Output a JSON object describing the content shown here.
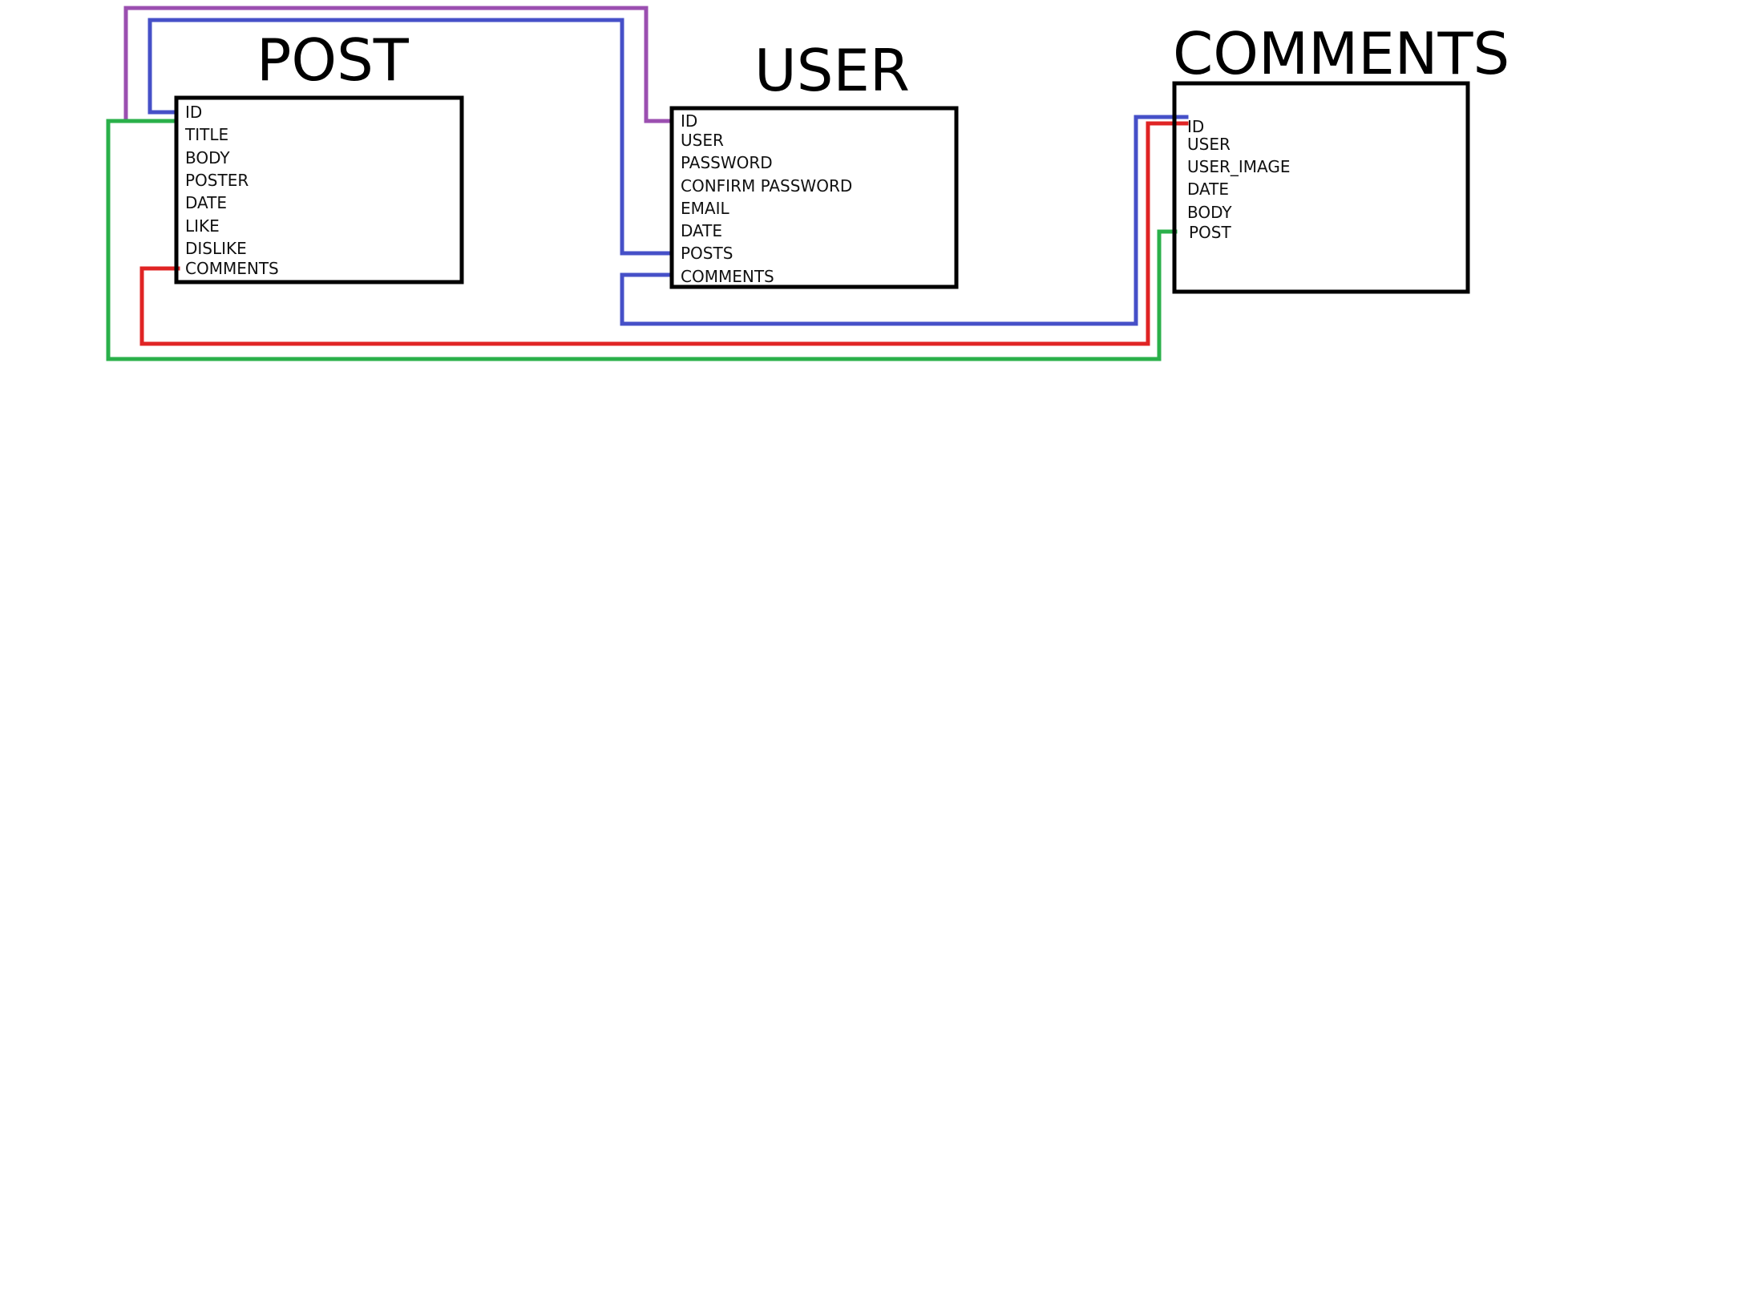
{
  "diagram": {
    "tables": {
      "post": {
        "title": "POST",
        "fields": [
          "ID",
          "TITLE",
          "BODY",
          "POSTER",
          "DATE",
          "LIKE",
          "DISLIKE",
          "COMMENTS"
        ]
      },
      "user": {
        "title": "USER",
        "fields": [
          "ID",
          "USER",
          "PASSWORD",
          "CONFIRM PASSWORD",
          "EMAIL",
          "DATE",
          "POSTS",
          "COMMENTS"
        ]
      },
      "comments": {
        "title": "COMMENTS",
        "fields": [
          "ID",
          "USER",
          "USER_IMAGE",
          "DATE",
          "BODY",
          "POST"
        ]
      }
    },
    "connector_colors": {
      "purple": "#9b4fb0",
      "blue": "#4650c8",
      "green": "#2ab04a",
      "red": "#e02424"
    }
  }
}
